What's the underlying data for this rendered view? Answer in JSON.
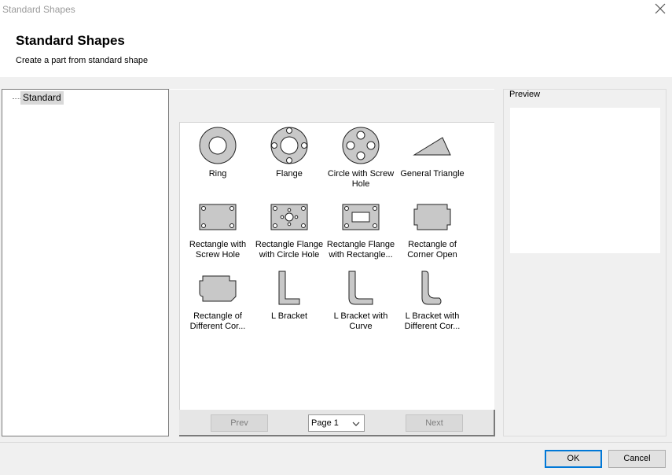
{
  "window": {
    "title": "Standard Shapes"
  },
  "header": {
    "title": "Standard Shapes",
    "subtitle": "Create a part from standard shape"
  },
  "tree": {
    "node": "Standard"
  },
  "shapes": [
    {
      "label": "Ring",
      "icon": "ring-icon"
    },
    {
      "label": "Flange",
      "icon": "flange-icon"
    },
    {
      "label": "Circle with Screw Hole",
      "icon": "circle-screw-hole-icon"
    },
    {
      "label": "General Triangle",
      "icon": "triangle-icon"
    },
    {
      "label": "Rectangle with Screw Hole",
      "icon": "rect-screw-hole-icon"
    },
    {
      "label": "Rectangle Flange with Circle Hole",
      "icon": "rect-flange-circle-icon"
    },
    {
      "label": "Rectangle Flange with Rectangle...",
      "icon": "rect-flange-rect-icon"
    },
    {
      "label": "Rectangle of Corner Open",
      "icon": "rect-corner-open-icon"
    },
    {
      "label": "Rectangle of Different Cor...",
      "icon": "rect-diff-corner-icon"
    },
    {
      "label": "L Bracket",
      "icon": "l-bracket-icon"
    },
    {
      "label": "L Bracket with Curve",
      "icon": "l-bracket-curve-icon"
    },
    {
      "label": "L Bracket with Different Cor...",
      "icon": "l-bracket-diff-icon"
    }
  ],
  "pager": {
    "prev": "Prev",
    "next": "Next",
    "page": "Page 1"
  },
  "preview": {
    "label": "Preview"
  },
  "buttons": {
    "ok": "OK",
    "cancel": "Cancel"
  }
}
